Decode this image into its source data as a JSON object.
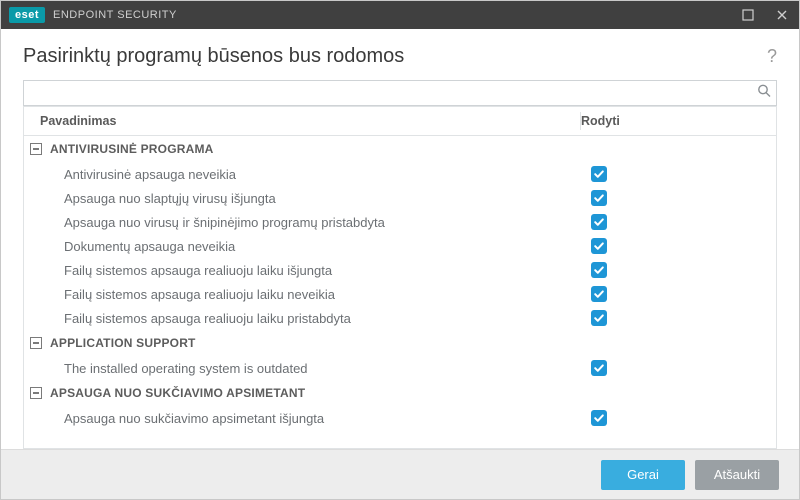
{
  "titlebar": {
    "brand": "eset",
    "product": "ENDPOINT SECURITY"
  },
  "header": {
    "title": "Pasirinktų programų būsenos bus rodomos"
  },
  "search": {
    "value": "",
    "placeholder": ""
  },
  "columns": {
    "name": "Pavadinimas",
    "show": "Rodyti"
  },
  "groups": [
    {
      "label": "ANTIVIRUSINĖ PROGRAMA",
      "expanded": true,
      "items": [
        {
          "name": "Antivirusinė apsauga neveikia",
          "checked": true
        },
        {
          "name": "Apsauga nuo slaptųjų virusų išjungta",
          "checked": true
        },
        {
          "name": "Apsauga nuo virusų ir šnipinėjimo programų pristabdyta",
          "checked": true
        },
        {
          "name": "Dokumentų apsauga neveikia",
          "checked": true
        },
        {
          "name": "Failų sistemos apsauga realiuoju laiku išjungta",
          "checked": true
        },
        {
          "name": "Failų sistemos apsauga realiuoju laiku neveikia",
          "checked": true
        },
        {
          "name": "Failų sistemos apsauga realiuoju laiku pristabdyta",
          "checked": true
        }
      ]
    },
    {
      "label": "APPLICATION SUPPORT",
      "expanded": true,
      "items": [
        {
          "name": "The installed operating system is outdated",
          "checked": true
        }
      ]
    },
    {
      "label": "APSAUGA NUO SUKČIAVIMO APSIMETANT",
      "expanded": true,
      "items": [
        {
          "name": "Apsauga nuo sukčiavimo apsimetant išjungta",
          "checked": true
        }
      ]
    }
  ],
  "footer": {
    "ok": "Gerai",
    "cancel": "Atšaukti"
  }
}
